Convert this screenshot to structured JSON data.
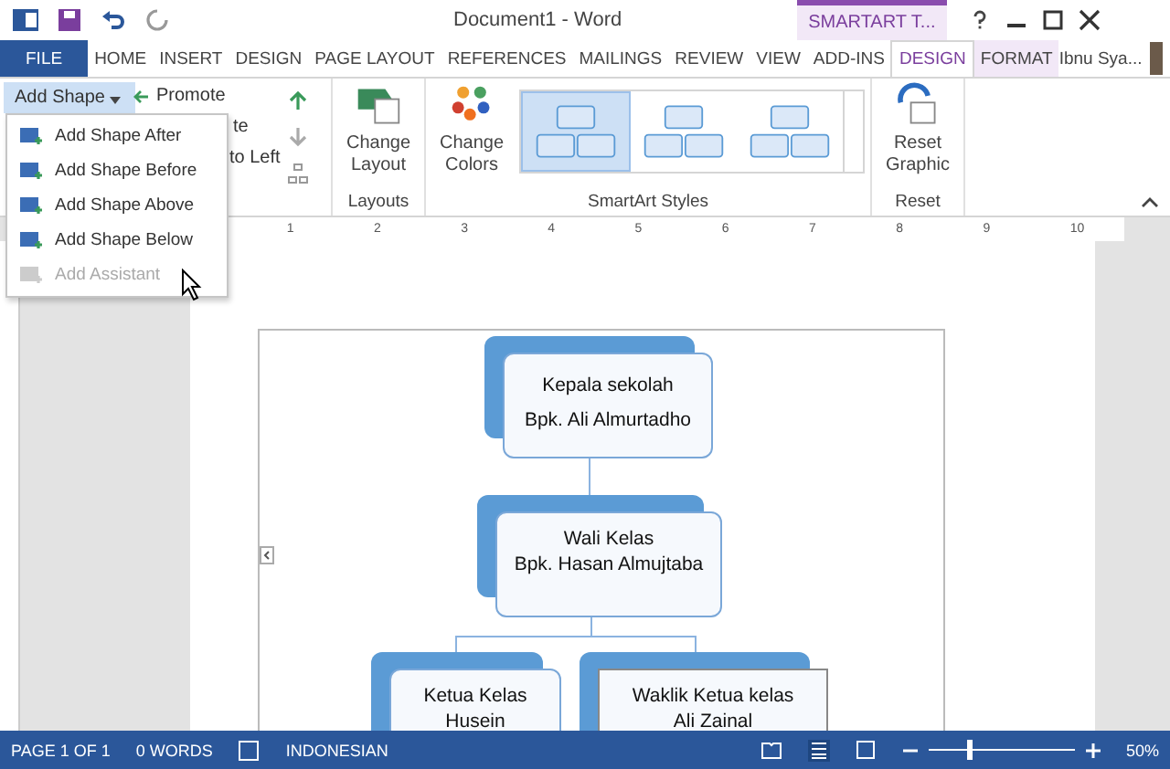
{
  "window": {
    "title": "Document1 - Word",
    "contextual_tab": "SMARTART T...",
    "user": "Ibnu Sya..."
  },
  "tabs": [
    {
      "label": "FILE",
      "kind": "file",
      "selected": false
    },
    {
      "label": "HOME",
      "kind": "tab",
      "selected": false
    },
    {
      "label": "INSERT",
      "kind": "tab",
      "selected": false
    },
    {
      "label": "DESIGN",
      "kind": "tab",
      "selected": false
    },
    {
      "label": "PAGE LAYOUT",
      "kind": "tab",
      "selected": false
    },
    {
      "label": "REFERENCES",
      "kind": "tab",
      "selected": false
    },
    {
      "label": "MAILINGS",
      "kind": "tab",
      "selected": false
    },
    {
      "label": "REVIEW",
      "kind": "tab",
      "selected": false
    },
    {
      "label": "VIEW",
      "kind": "tab",
      "selected": false
    },
    {
      "label": "ADD-INS",
      "kind": "tab",
      "selected": false
    },
    {
      "label": "DESIGN",
      "kind": "contextual",
      "selected": true
    },
    {
      "label": "FORMAT",
      "kind": "contextual",
      "selected": false
    }
  ],
  "ribbon": {
    "add_shape": "Add Shape",
    "promote": "Promote",
    "demote": "te",
    "right_to_left": "to Left",
    "change_layout": "Change Layout",
    "layouts_group": "Layouts",
    "change_colors": "Change Colors",
    "styles": [
      {
        "selected": true
      },
      {
        "selected": false
      },
      {
        "selected": false
      }
    ],
    "styles_group": "SmartArt Styles",
    "reset_graphic": "Reset Graphic",
    "reset_group": "Reset"
  },
  "menu": {
    "items": [
      {
        "label": "Add Shape After",
        "disabled": false
      },
      {
        "label": "Add Shape Before",
        "disabled": false
      },
      {
        "label": "Add Shape Above",
        "disabled": false
      },
      {
        "label": "Add Shape Below",
        "disabled": false
      },
      {
        "label": "Add Assistant",
        "disabled": true
      }
    ]
  },
  "ruler": {
    "ticks": [
      "1",
      "2",
      "3",
      "4",
      "5",
      "6",
      "7",
      "8",
      "9",
      "10"
    ]
  },
  "diagram": {
    "nodes": [
      {
        "lines": [
          "Kepala sekolah",
          "Bpk. Ali Almurtadho"
        ],
        "selected": false
      },
      {
        "lines": [
          "Wali Kelas",
          "Bpk. Hasan Almujtaba"
        ],
        "selected": false
      },
      {
        "lines": [
          "Ketua Kelas",
          "Husein"
        ],
        "selected": false
      },
      {
        "lines": [
          "Waklik Ketua kelas",
          "Ali Zainal"
        ],
        "selected": true
      }
    ]
  },
  "status_bar": {
    "page": "PAGE 1 OF 1",
    "words": "0 WORDS",
    "language": "INDONESIAN",
    "zoom": "50%",
    "zoom_slider": {
      "level": 0.26
    }
  }
}
